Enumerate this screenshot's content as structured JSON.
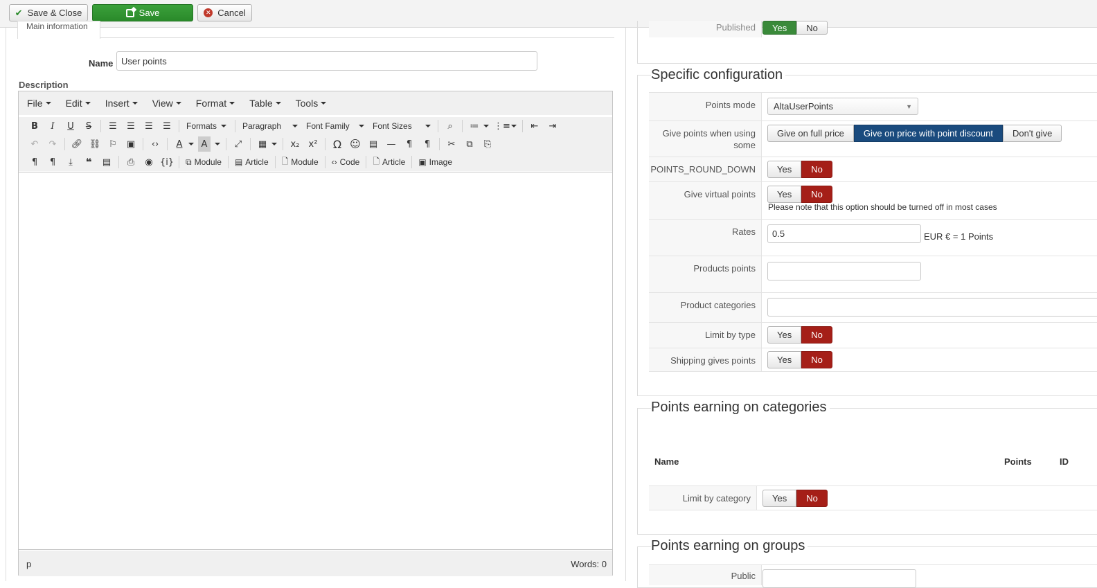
{
  "toolbar": {
    "save_close": "Save & Close",
    "save": "Save",
    "cancel": "Cancel"
  },
  "main": {
    "tab_label": "Main information",
    "name_label": "Name",
    "name_value": "User points",
    "description_label": "Description"
  },
  "editor": {
    "menu": [
      "File",
      "Edit",
      "Insert",
      "View",
      "Format",
      "Table",
      "Tools"
    ],
    "formats": "Formats",
    "paragraph": "Paragraph",
    "font_family": "Font Family",
    "font_sizes": "Font Sizes",
    "btn_module": "Module",
    "btn_article": "Article",
    "btn_module2": "Module",
    "btn_code": "Code",
    "btn_article2": "Article",
    "btn_image": "Image",
    "status_path": "p",
    "status_words": "Words: 0"
  },
  "publishing": {
    "published_label": "Published",
    "yes": "Yes",
    "no": "No"
  },
  "specific": {
    "legend": "Specific configuration",
    "points_mode_label": "Points mode",
    "points_mode_value": "AltaUserPoints",
    "give_points_label": "Give points when using some",
    "give_full": "Give on full price",
    "give_discount": "Give on price with point discount",
    "dont_give": "Don't give",
    "round_down_label": "POINTS_ROUND_DOWN",
    "virtual_label": "Give virtual points",
    "virtual_note": "Please note that this option should be turned off in most cases",
    "rates_label": "Rates",
    "rates_value": "0.5",
    "rates_suffix": "EUR € = 1 Points",
    "products_points_label": "Products points",
    "product_categories_label": "Product categories",
    "limit_type_label": "Limit by type",
    "shipping_label": "Shipping gives points",
    "yes": "Yes",
    "no": "No"
  },
  "categories": {
    "legend": "Points earning on categories",
    "col_name": "Name",
    "col_points": "Points",
    "col_id": "ID",
    "limit_label": "Limit by category",
    "yes": "Yes",
    "no": "No"
  },
  "groups": {
    "legend": "Points earning on groups",
    "public_label": "Public"
  }
}
